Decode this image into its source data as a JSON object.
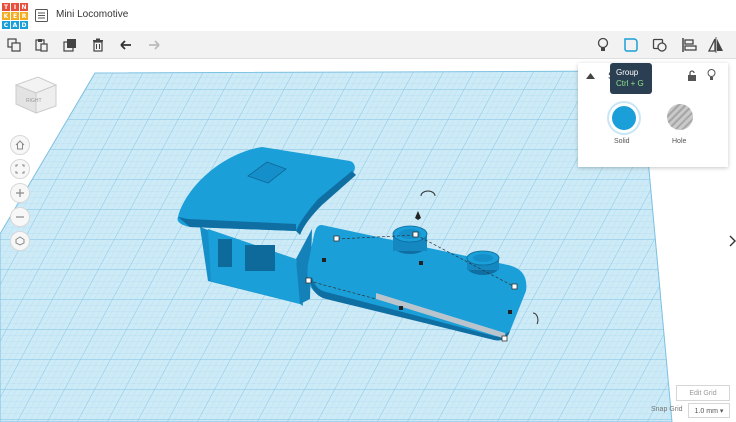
{
  "app": {
    "logo_letters": [
      "T",
      "I",
      "N",
      "K",
      "E",
      "R",
      "C",
      "A",
      "D"
    ],
    "logo_colors": [
      "#e84e3c",
      "#e84e3c",
      "#e84e3c",
      "#f3ac1e",
      "#f3ac1e",
      "#f3ac1e",
      "#1a9fd8",
      "#1a9fd8",
      "#1a9fd8"
    ],
    "title": "Mini Locomotive"
  },
  "toolbar": {
    "left_icons": [
      "copy-icon",
      "paste-icon",
      "duplicate-icon",
      "delete-icon",
      "undo-icon",
      "redo-icon"
    ],
    "right_icons": [
      "lightbulb-icon",
      "group-icon",
      "ungroup-icon",
      "align-icon",
      "mirror-icon"
    ]
  },
  "tooltip": {
    "title": "Group",
    "shortcut": "Ctrl + G"
  },
  "shape_panel": {
    "title": "S",
    "options": [
      {
        "label": "Solid",
        "color": "#1a9fd8"
      },
      {
        "label": "Hole",
        "color": "#b9b9b9"
      }
    ]
  },
  "viewcube": {
    "face_label": "RIGHT"
  },
  "nav_buttons": [
    "home-icon",
    "fit-icon",
    "zoom-in-icon",
    "zoom-out-icon",
    "perspective-icon"
  ],
  "grid": {
    "edit_label": "Edit Grid",
    "snap_label": "Snap Grid",
    "snap_value": "1.0 mm ▾"
  },
  "colors": {
    "shape": "#1a9fd8",
    "shape_dark": "#0f6fa3",
    "grid": "#cdeaf7"
  }
}
